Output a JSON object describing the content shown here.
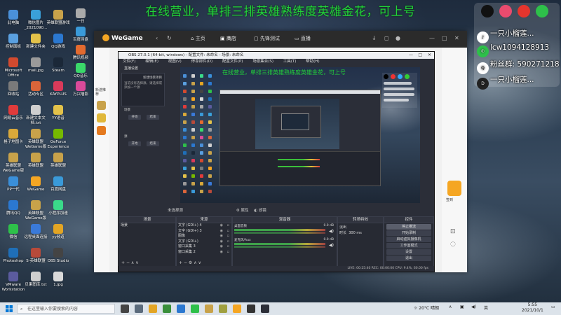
{
  "overlay_banner": "在线营业，单排三排英雄熟练度英雄金花，可上号",
  "desktop_icons": [
    {
      "label": "此电脑"
    },
    {
      "label": "控制面板"
    },
    {
      "label": "Microsoft Office"
    },
    {
      "label": "回收站"
    },
    {
      "label": "网易云音乐"
    },
    {
      "label": "格子地图卡"
    },
    {
      "label": "英雄联盟 WeGame版"
    },
    {
      "label": "PP一代"
    },
    {
      "label": "腾讯QQ"
    },
    {
      "label": "微信"
    },
    {
      "label": "Photoshop"
    },
    {
      "label": "VMware Workstation"
    },
    {
      "label": "微信图片_2021090..."
    },
    {
      "label": "新建文件夹"
    },
    {
      "label": "mail.jpg"
    },
    {
      "label": "活动专区"
    },
    {
      "label": "新建文本文档.txt"
    },
    {
      "label": "英雄联盟 WeGame版"
    },
    {
      "label": "英雄联盟"
    },
    {
      "label": "WeGame"
    },
    {
      "label": "英雄联盟 WeGame版"
    },
    {
      "label": "远程桌面连接"
    },
    {
      "label": "S-英雄联盟"
    },
    {
      "label": "贝果图库.txt"
    },
    {
      "label": "英雄联盟游戏"
    },
    {
      "label": "QQ游戏"
    },
    {
      "label": "Steam"
    },
    {
      "label": "KAYPLUS"
    },
    {
      "label": "YY语音"
    },
    {
      "label": "GeForce Experience"
    },
    {
      "label": "英雄联盟"
    },
    {
      "label": "百度网盘"
    },
    {
      "label": "小程序加速"
    },
    {
      "label": "yy频道"
    },
    {
      "label": "OBS Studio"
    },
    {
      "label": "1.jpg"
    },
    {
      "label": "一日"
    },
    {
      "label": "百度网盘"
    },
    {
      "label": "腾讯视频"
    },
    {
      "label": "QQ音乐"
    },
    {
      "label": "万兴喵影"
    }
  ],
  "wegame": {
    "logo": "WeGame",
    "nav": [
      {
        "label": "主页"
      },
      {
        "label": "商店"
      },
      {
        "label": "先锋测试"
      },
      {
        "label": "直播"
      }
    ],
    "left_tabs": [
      "新游推荐"
    ],
    "right_labels": [
      "签到"
    ]
  },
  "obs": {
    "title": "OBS 27.0.1 (64-bit, windows) - 配置文件: 未命名 - 场景: 未命名",
    "menu": [
      "文件(F)",
      "编辑(E)",
      "视图(V)",
      "停靠部件(D)",
      "配置文件(P)",
      "场景集合(S)",
      "工具(T)",
      "帮助(H)"
    ],
    "props": {
      "header": "直播设置",
      "line1": "新建场景项目",
      "line2": "当前没有选择源，请选择或添加一个源",
      "group1": "场景",
      "group2": "源",
      "btn_start": "开始",
      "btn_stop": "结束"
    },
    "filter_bar": {
      "label": "未选择源",
      "props_btn": "属性",
      "filters_btn": "滤镜"
    },
    "docks": {
      "scenes": {
        "title": "场景",
        "items": [
          "场景"
        ]
      },
      "sources": {
        "title": "来源",
        "items": [
          "文字 (GDI+) 4",
          "文字 (GDI+) 3",
          "图像",
          "文字 (GDI+)",
          "窗口采集 3",
          "窗口采集 2"
        ]
      },
      "mixer": {
        "title": "混音器",
        "rows": [
          {
            "label": "桌面音频",
            "db": "0.0 dB"
          },
          {
            "label": "麦克风/Aux",
            "db": "0.0 dB"
          }
        ]
      },
      "transitions": {
        "title": "转场特效",
        "type": "淡出",
        "duration_label": "时长",
        "duration": "300 ms"
      },
      "controls": {
        "title": "控件",
        "buttons": [
          "停止推流",
          "开始录制",
          "启动虚拟摄像机",
          "工作室模式",
          "设置",
          "退出"
        ]
      }
    },
    "status": "LIVE: 00:25:40   REC: 00:00:00   CPU: 9.4%, 60.00 fps"
  },
  "social": {
    "handle": "一只小榴莲...",
    "wechat": "lcw1094128913",
    "fans_group": "粉丝群: 590271218",
    "streamer": "一只小榴莲..."
  },
  "taskbar": {
    "search_placeholder": "在这里输入你要搜索的内容",
    "weather": "20°C 晴朗",
    "ime": "英",
    "time": "5:55",
    "date": "2021/10/1"
  },
  "colors": {
    "banner": "#22d33a",
    "obs_bg": "#2b2e38",
    "wegame_accent": "#f5a623"
  }
}
